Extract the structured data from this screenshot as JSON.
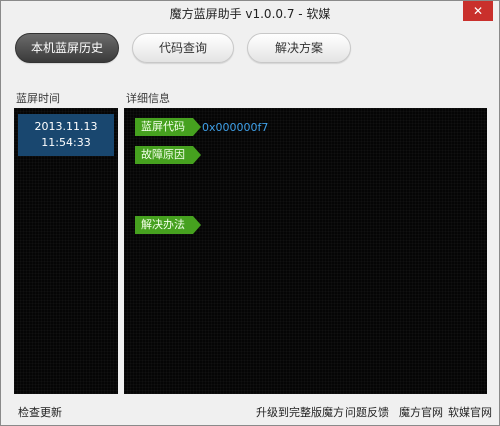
{
  "window": {
    "title": "魔方蓝屏助手 v1.0.0.7 - 软媒",
    "close_label": "✕"
  },
  "tabs": [
    {
      "label": "本机蓝屏历史",
      "active": true
    },
    {
      "label": "代码查询",
      "active": false
    },
    {
      "label": "解决方案",
      "active": false
    }
  ],
  "left": {
    "header": "蓝屏时间",
    "history": [
      {
        "date": "2013.11.13",
        "time": "11:54:33",
        "selected": true
      }
    ]
  },
  "right": {
    "header": "详细信息",
    "bsod_code_label": "蓝屏代码",
    "bsod_code_value": "0x000000f7",
    "cause_label": "故障原因",
    "solution_label": "解决办法"
  },
  "footer": {
    "check_update": "检查更新",
    "upgrade": "升级到完整版魔方",
    "feedback": "问题反馈",
    "mofang_site": "魔方官网",
    "ruanmei_site": "软媒官网"
  },
  "colors": {
    "active_tab": "#4a4a4a",
    "selected_item": "#19476f",
    "tag_green": "#46a11f",
    "code_blue": "#3fa0e8",
    "close_red": "#c9302c"
  }
}
